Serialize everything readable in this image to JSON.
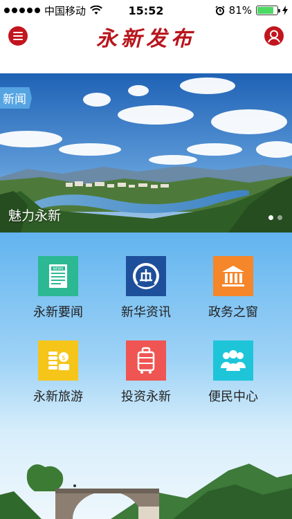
{
  "status_bar": {
    "carrier": "中国移动",
    "time": "15:52",
    "battery": "81%",
    "battery_level": 0.81
  },
  "header": {
    "title": "永新发布",
    "menu_icon": "menu-icon",
    "user_icon": "user-icon",
    "brand_color": "#c3151e"
  },
  "banner": {
    "tag": "新闻",
    "caption": "魅力永新",
    "page_count": 2,
    "active_page": 1
  },
  "grid": {
    "items": [
      {
        "label": "永新要闻",
        "icon": "news-icon",
        "color": "#2bb893"
      },
      {
        "label": "新华资讯",
        "icon": "xinhua-logo-icon",
        "color": "#1e4f9a"
      },
      {
        "label": "政务之窗",
        "icon": "government-building-icon",
        "color": "#f5862a"
      },
      {
        "label": "永新旅游",
        "icon": "tourism-coins-icon",
        "color": "#f6c51a"
      },
      {
        "label": "投资永新",
        "icon": "suitcase-icon",
        "color": "#ef5552"
      },
      {
        "label": "便民中心",
        "icon": "people-icon",
        "color": "#1ec5d9"
      }
    ]
  }
}
